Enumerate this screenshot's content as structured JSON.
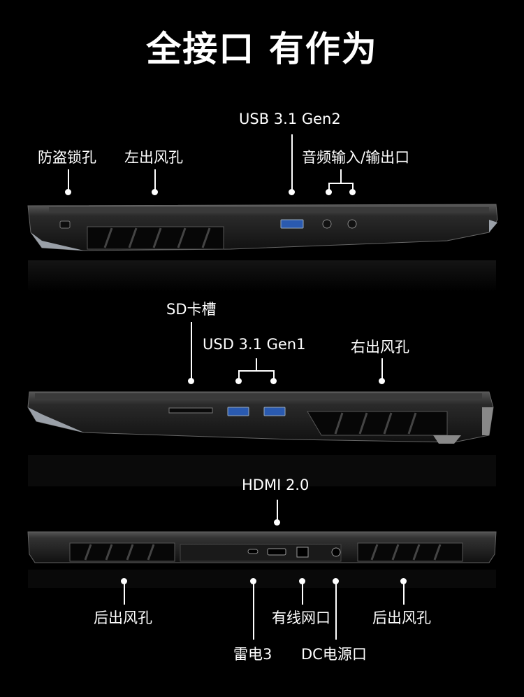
{
  "title": "全接口 有作为",
  "left_side": {
    "labels": {
      "lock": "防盗锁孔",
      "vent": "左出风孔",
      "usb": "USB 3.1 Gen2",
      "audio": "音频输入/输出口"
    }
  },
  "right_side": {
    "labels": {
      "sd": "SD卡槽",
      "usb": "USD 3.1 Gen1",
      "vent": "右出风孔"
    }
  },
  "rear_side": {
    "labels": {
      "hdmi": "HDMI 2.0",
      "vent_left": "后出风孔",
      "thunderbolt": "雷电3",
      "ethernet": "有线网口",
      "dc": "DC电源口",
      "vent_right": "后出风孔"
    }
  }
}
